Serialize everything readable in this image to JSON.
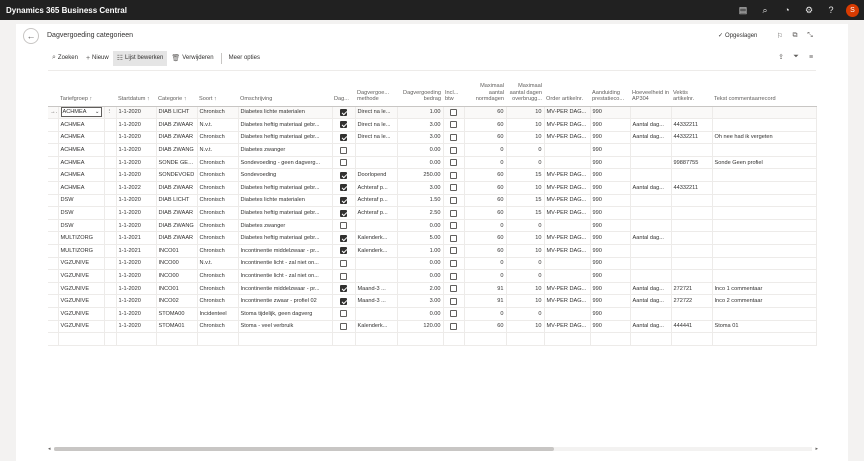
{
  "app": {
    "title": "Dynamics 365 Business Central",
    "avatar": "S"
  },
  "page": {
    "title": "Dagvergoeding categorieen",
    "saved": "Opgeslagen"
  },
  "actions": {
    "search": "Zoeken",
    "new": "Nieuw",
    "edit_list": "Lijst bewerken",
    "delete": "Verwijderen",
    "more": "Meer opties"
  },
  "columns": {
    "tariefgroep": "Tariefgroep ↑",
    "startdatum": "Startdatum ↑",
    "categorie": "Categorie ↑",
    "soort": "Soort ↑",
    "omschrijving": "Omschrijving",
    "dag": "Dag...",
    "methode": "Dagvergoe... methode",
    "bedrag": "Dagvergoeding bedrag",
    "incl_btw": "Incl... btw",
    "max_normdagen": "Maximaal aantal normdagen",
    "max_overbrugging": "Maximaal aantal dagen overbrugg...",
    "order_artikelnr": "Order artikelnr.",
    "aanduiding": "Aanduiding prestatieco...",
    "hoeveelheid": "Hoeveelheid in AP304",
    "vektis": "Vektis artikelnr.",
    "tekst": "Tekst commentaarrecord"
  },
  "rows": [
    {
      "tariefgroep": "ACHMEA",
      "startdatum": "1-1-2020",
      "categorie": "DIAB LICHT",
      "soort": "Chronisch",
      "omschrijving": "Diabetes lichte materialen",
      "dag": true,
      "methode": "Direct na le...",
      "bedrag": "1.00",
      "incl_btw": false,
      "max_normdagen": "60",
      "max_overbrugging": "10",
      "order_artikelnr": "MV-PER DAG...",
      "aanduiding": "990",
      "hoeveelheid": "",
      "vektis": "",
      "tekst": ""
    },
    {
      "tariefgroep": "ACHMEA",
      "startdatum": "1-1-2020",
      "categorie": "DIAB ZWAAR",
      "soort": "N.v.t.",
      "omschrijving": "Diabetes heftig materiaal gebr...",
      "dag": true,
      "methode": "Direct na le...",
      "bedrag": "3.00",
      "incl_btw": false,
      "max_normdagen": "60",
      "max_overbrugging": "10",
      "order_artikelnr": "MV-PER DAG...",
      "aanduiding": "990",
      "hoeveelheid": "Aantal dag...",
      "vektis": "44332211",
      "tekst": ""
    },
    {
      "tariefgroep": "ACHMEA",
      "startdatum": "1-1-2020",
      "categorie": "DIAB ZWAAR",
      "soort": "Chronisch",
      "omschrijving": "Diabetes heftig materiaal gebr...",
      "dag": true,
      "methode": "Direct na le...",
      "bedrag": "3.00",
      "incl_btw": false,
      "max_normdagen": "60",
      "max_overbrugging": "10",
      "order_artikelnr": "MV-PER DAG...",
      "aanduiding": "990",
      "hoeveelheid": "Aantal dag...",
      "vektis": "44332211",
      "tekst": "Oh nee had ik vergeten"
    },
    {
      "tariefgroep": "ACHMEA",
      "startdatum": "1-1-2020",
      "categorie": "DIAB ZWANG",
      "soort": "N.v.t.",
      "omschrijving": "Diabetes zwanger",
      "dag": false,
      "methode": "",
      "bedrag": "0.00",
      "incl_btw": false,
      "max_normdagen": "0",
      "max_overbrugging": "0",
      "order_artikelnr": "",
      "aanduiding": "990",
      "hoeveelheid": "",
      "vektis": "",
      "tekst": ""
    },
    {
      "tariefgroep": "ACHMEA",
      "startdatum": "1-1-2020",
      "categorie": "SONDE GEEN",
      "soort": "Chronisch",
      "omschrijving": "Sondevoeding - geen dagverg...",
      "dag": false,
      "methode": "",
      "bedrag": "0.00",
      "incl_btw": false,
      "max_normdagen": "0",
      "max_overbrugging": "0",
      "order_artikelnr": "",
      "aanduiding": "990",
      "hoeveelheid": "",
      "vektis": "99887755",
      "tekst": "Sonde Geen profiel"
    },
    {
      "tariefgroep": "ACHMEA",
      "startdatum": "1-1-2020",
      "categorie": "SONDEVOED",
      "soort": "Chronisch",
      "omschrijving": "Sondevoeding",
      "dag": true,
      "methode": "Doorlopend",
      "bedrag": "250.00",
      "incl_btw": false,
      "max_normdagen": "60",
      "max_overbrugging": "15",
      "order_artikelnr": "MV-PER DAG...",
      "aanduiding": "990",
      "hoeveelheid": "",
      "vektis": "",
      "tekst": ""
    },
    {
      "tariefgroep": "ACHMEA",
      "startdatum": "1-1-2022",
      "categorie": "DIAB ZWAAR",
      "soort": "Chronisch",
      "omschrijving": "Diabetes heftig materiaal gebr...",
      "dag": true,
      "methode": "Achteraf p...",
      "bedrag": "3.00",
      "incl_btw": false,
      "max_normdagen": "60",
      "max_overbrugging": "10",
      "order_artikelnr": "MV-PER DAG...",
      "aanduiding": "990",
      "hoeveelheid": "Aantal dag...",
      "vektis": "44332211",
      "tekst": ""
    },
    {
      "tariefgroep": "DSW",
      "startdatum": "1-1-2020",
      "categorie": "DIAB LICHT",
      "soort": "Chronisch",
      "omschrijving": "Diabetes lichte materialen",
      "dag": true,
      "methode": "Achteraf p...",
      "bedrag": "1.50",
      "incl_btw": false,
      "max_normdagen": "60",
      "max_overbrugging": "15",
      "order_artikelnr": "MV-PER DAG...",
      "aanduiding": "990",
      "hoeveelheid": "",
      "vektis": "",
      "tekst": ""
    },
    {
      "tariefgroep": "DSW",
      "startdatum": "1-1-2020",
      "categorie": "DIAB ZWAAR",
      "soort": "Chronisch",
      "omschrijving": "Diabetes heftig materiaal gebr...",
      "dag": true,
      "methode": "Achteraf p...",
      "bedrag": "2.50",
      "incl_btw": false,
      "max_normdagen": "60",
      "max_overbrugging": "15",
      "order_artikelnr": "MV-PER DAG...",
      "aanduiding": "990",
      "hoeveelheid": "",
      "vektis": "",
      "tekst": ""
    },
    {
      "tariefgroep": "DSW",
      "startdatum": "1-1-2020",
      "categorie": "DIAB ZWANG",
      "soort": "Chronisch",
      "omschrijving": "Diabetes zwanger",
      "dag": false,
      "methode": "",
      "bedrag": "0.00",
      "incl_btw": false,
      "max_normdagen": "0",
      "max_overbrugging": "0",
      "order_artikelnr": "",
      "aanduiding": "990",
      "hoeveelheid": "",
      "vektis": "",
      "tekst": ""
    },
    {
      "tariefgroep": "MULTIZORG",
      "startdatum": "1-1-2021",
      "categorie": "DIAB ZWAAR",
      "soort": "Chronisch",
      "omschrijving": "Diabetes heftig materiaal gebr...",
      "dag": true,
      "methode": "Kalenderk...",
      "bedrag": "5.00",
      "incl_btw": false,
      "max_normdagen": "60",
      "max_overbrugging": "10",
      "order_artikelnr": "MV-PER DAG...",
      "aanduiding": "990",
      "hoeveelheid": "Aantal dag...",
      "vektis": "",
      "tekst": ""
    },
    {
      "tariefgroep": "MULTIZORG",
      "startdatum": "1-1-2021",
      "categorie": "INCO01",
      "soort": "Chronisch",
      "omschrijving": "Incontinentie middelzwaar - pr...",
      "dag": true,
      "methode": "Kalenderk...",
      "bedrag": "1.00",
      "incl_btw": false,
      "max_normdagen": "60",
      "max_overbrugging": "10",
      "order_artikelnr": "MV-PER DAG...",
      "aanduiding": "990",
      "hoeveelheid": "",
      "vektis": "",
      "tekst": ""
    },
    {
      "tariefgroep": "VGZUNIVE",
      "startdatum": "1-1-2020",
      "categorie": "INCO00",
      "soort": "N.v.t.",
      "omschrijving": "Incontinentie licht - zal niet on...",
      "dag": false,
      "methode": "",
      "bedrag": "0.00",
      "incl_btw": false,
      "max_normdagen": "0",
      "max_overbrugging": "0",
      "order_artikelnr": "",
      "aanduiding": "990",
      "hoeveelheid": "",
      "vektis": "",
      "tekst": ""
    },
    {
      "tariefgroep": "VGZUNIVE",
      "startdatum": "1-1-2020",
      "categorie": "INCO00",
      "soort": "Chronisch",
      "omschrijving": "Incontinentie licht - zal niet on...",
      "dag": false,
      "methode": "",
      "bedrag": "0.00",
      "incl_btw": false,
      "max_normdagen": "0",
      "max_overbrugging": "0",
      "order_artikelnr": "",
      "aanduiding": "990",
      "hoeveelheid": "",
      "vektis": "",
      "tekst": ""
    },
    {
      "tariefgroep": "VGZUNIVE",
      "startdatum": "1-1-2020",
      "categorie": "INCO01",
      "soort": "Chronisch",
      "omschrijving": "Incontinentie middelzwaar - pr...",
      "dag": true,
      "methode": "Maand-3 ...",
      "bedrag": "2.00",
      "incl_btw": false,
      "max_normdagen": "91",
      "max_overbrugging": "10",
      "order_artikelnr": "MV-PER DAG...",
      "aanduiding": "990",
      "hoeveelheid": "Aantal dag...",
      "vektis": "272721",
      "tekst": "Inco 1 commentaar"
    },
    {
      "tariefgroep": "VGZUNIVE",
      "startdatum": "1-1-2020",
      "categorie": "INCO02",
      "soort": "Chronisch",
      "omschrijving": "Incontinentie zwaar - profiel 02",
      "dag": true,
      "methode": "Maand-3 ...",
      "bedrag": "3.00",
      "incl_btw": false,
      "max_normdagen": "91",
      "max_overbrugging": "10",
      "order_artikelnr": "MV-PER DAG...",
      "aanduiding": "990",
      "hoeveelheid": "Aantal dag...",
      "vektis": "272722",
      "tekst": "Inco 2 commentaar"
    },
    {
      "tariefgroep": "VGZUNIVE",
      "startdatum": "1-1-2020",
      "categorie": "STOMA00",
      "soort": "Incidenteel",
      "omschrijving": "Stoma tijdelijk, geen dagverg",
      "dag": false,
      "methode": "",
      "bedrag": "0.00",
      "incl_btw": false,
      "max_normdagen": "0",
      "max_overbrugging": "0",
      "order_artikelnr": "",
      "aanduiding": "990",
      "hoeveelheid": "",
      "vektis": "",
      "tekst": ""
    },
    {
      "tariefgroep": "VGZUNIVE",
      "startdatum": "1-1-2020",
      "categorie": "STOMA01",
      "soort": "Chronisch",
      "omschrijving": "Stoma - veel verbruik",
      "dag": false,
      "methode": "Kalenderk...",
      "bedrag": "120.00",
      "incl_btw": false,
      "max_normdagen": "60",
      "max_overbrugging": "10",
      "order_artikelnr": "MV-PER DAG...",
      "aanduiding": "990",
      "hoeveelheid": "Aantal dag...",
      "vektis": "444441",
      "tekst": "Stoma 01"
    }
  ]
}
